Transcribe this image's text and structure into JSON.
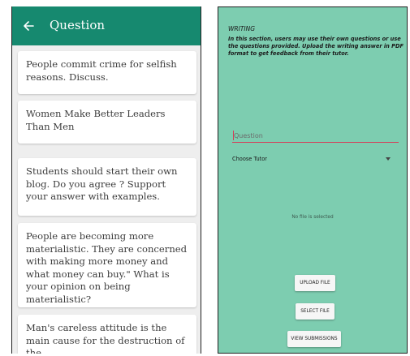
{
  "question_screen": {
    "title": "Question",
    "questions": [
      "People commit crime for selfish reasons. Discuss.",
      "Women Make Better Leaders Than Men",
      "Students should start their own blog. Do you agree ? Support your answer with examples.",
      "People are becoming more materialistic. They are concerned with making more money and what money can buy.\" What is your opinion on being materialistic?",
      "Man's careless attitude is the main cause for the destruction of the"
    ]
  },
  "writing_screen": {
    "section_title": "WRITING",
    "description": "In this section, users may use their own questions or use the questions provided. Upload the writing answer in PDF format to get feedback from their tutor.",
    "question_placeholder": "Question",
    "tutor_select": "Choose Tutor",
    "file_status": "No file is selected",
    "upload_button": "UPLOAD FILE",
    "select_button": "SELECT FILE",
    "view_button": "VIEW SUBMISSIONS"
  },
  "colors": {
    "app_bar": "#16896f",
    "writing_background": "#7dcdb0",
    "input_underline": "#d63b57"
  }
}
